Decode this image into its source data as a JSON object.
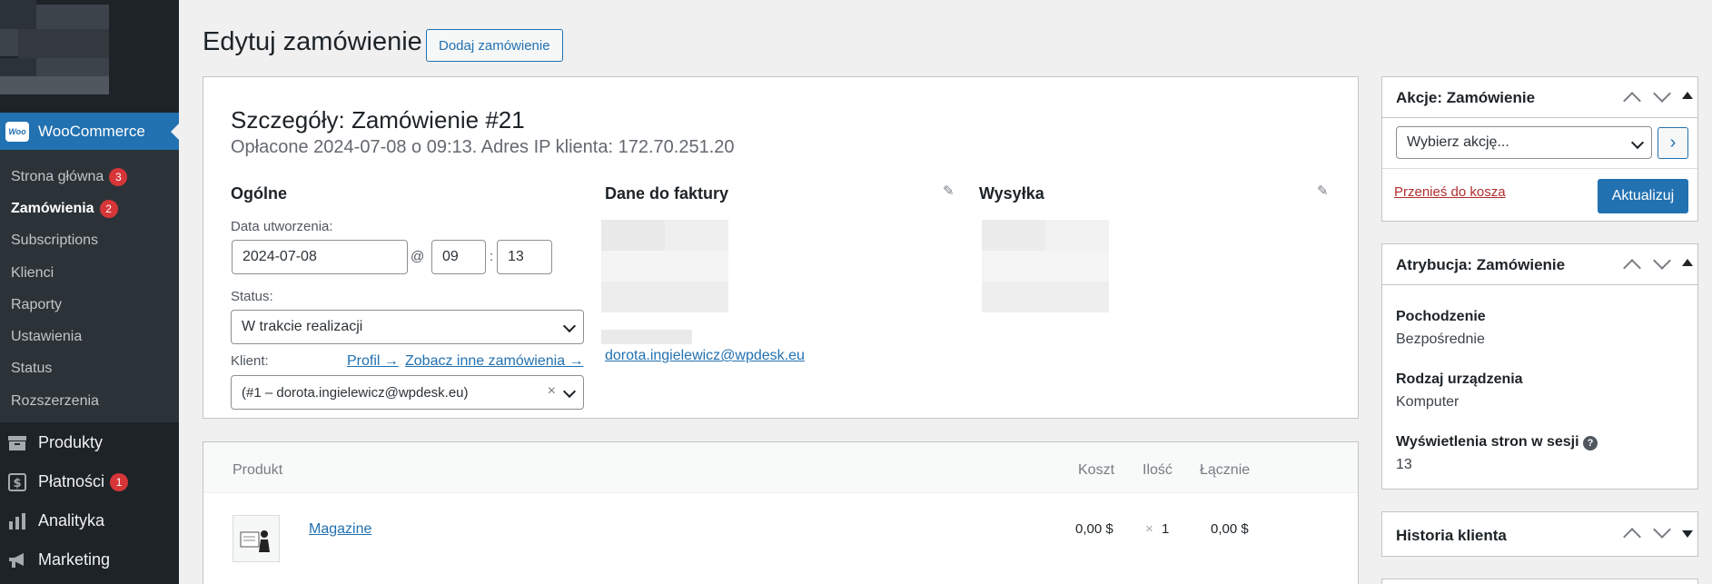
{
  "sidebar": {
    "woocommerce_label": "WooCommerce",
    "woo_logo_text": "Woo",
    "submenu": [
      {
        "label": "Strona główna",
        "badge": "3"
      },
      {
        "label": "Zamówienia",
        "badge": "2",
        "active": true
      },
      {
        "label": "Subscriptions"
      },
      {
        "label": "Klienci"
      },
      {
        "label": "Raporty"
      },
      {
        "label": "Ustawienia"
      },
      {
        "label": "Status"
      },
      {
        "label": "Rozszerzenia"
      }
    ],
    "menu": [
      {
        "label": "Produkty",
        "icon": "archive-icon"
      },
      {
        "label": "Płatności",
        "icon": "dollar-icon",
        "badge": "1"
      },
      {
        "label": "Analityka",
        "icon": "bar-chart-icon"
      },
      {
        "label": "Marketing",
        "icon": "megaphone-icon"
      }
    ]
  },
  "header": {
    "title": "Edytuj zamówienie",
    "add_button": "Dodaj zamówienie"
  },
  "order": {
    "heading": "Szczegóły: Zamówienie #21",
    "meta": "Opłacone 2024-07-08 o 09:13. Adres IP klienta: 172.70.251.20",
    "general_title": "Ogólne",
    "billing_title": "Dane do faktury",
    "shipping_title": "Wysyłka",
    "date_label": "Data utworzenia:",
    "date_value": "2024-07-08",
    "at_sign": "@",
    "hour_value": "09",
    "colon": ":",
    "minute_value": "13",
    "status_label": "Status:",
    "status_value": "W trakcie realizacji",
    "customer_label": "Klient:",
    "profile_link": "Profil →",
    "other_orders_link": "Zobacz inne zamówienia →",
    "customer_value": "(#1 – dorota.ingielewicz@wpdesk.eu)",
    "clear_symbol": "×",
    "billing_email": "dorota.ingielewicz@wpdesk.eu"
  },
  "items": {
    "headers": {
      "product": "Produkt",
      "cost": "Koszt",
      "qty": "Ilość",
      "total": "Łącznie"
    },
    "rows": [
      {
        "name": "Magazine",
        "cost": "0,00 $",
        "qty_prefix": "×",
        "qty": "1",
        "total": "0,00 $"
      }
    ]
  },
  "actions_panel": {
    "title": "Akcje: Zamówienie",
    "select_placeholder": "Wybierz akcję...",
    "go_symbol": "›",
    "trash_link": "Przenieś do kosza",
    "update_button": "Aktualizuj"
  },
  "attribution_panel": {
    "title": "Atrybucja: Zamówienie",
    "origin_label": "Pochodzenie",
    "origin_value": "Bezpośrednie",
    "device_label": "Rodzaj urządzenia",
    "device_value": "Komputer",
    "pageviews_label": "Wyświetlenia stron w sesji",
    "help_symbol": "?",
    "pageviews_value": "13"
  },
  "history_panel": {
    "title": "Historia klienta"
  },
  "colors": {
    "accent": "#2271b1",
    "sidebar_bg": "#1d2327",
    "submenu_bg": "#2c3338",
    "badge": "#d63638",
    "trash": "#b32d2e"
  }
}
